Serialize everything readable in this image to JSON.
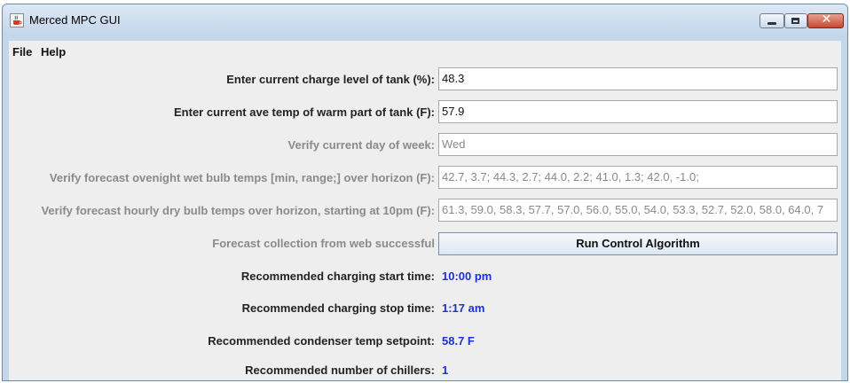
{
  "window": {
    "title": "Merced MPC GUI",
    "close_glyph": "✕"
  },
  "menu": {
    "items": [
      "File",
      "Help"
    ]
  },
  "form": {
    "charge_label": "Enter current charge level of tank (%):",
    "charge_value": "48.3",
    "temp_label": "Enter current ave temp of warm part of tank (F):",
    "temp_value": "57.9",
    "day_label": "Verify current day of week:",
    "day_value": "Wed",
    "wetbulb_label": "Verify forecast ovenight wet bulb temps [min, range;] over horizon (F):",
    "wetbulb_value": "42.7, 3.7; 44.3, 2.7; 44.0, 2.2; 41.0, 1.3; 42.0, -1.0;",
    "drybulb_label": "Verify forecast hourly dry bulb temps over horizon, starting at 10pm (F):",
    "drybulb_value": "61.3, 59.0, 58.3, 57.7, 57.0, 56.0, 55.0, 54.0, 53.3, 52.7, 52.0, 58.0, 64.0, 7",
    "status_label": "Forecast collection from web successful",
    "run_button": "Run Control Algorithm"
  },
  "results": {
    "start_label": "Recommended charging start time:",
    "start_value": "10:00 pm",
    "stop_label": "Recommended charging stop time:",
    "stop_value": "1:17 am",
    "setpoint_label": "Recommended condenser temp setpoint:",
    "setpoint_value": "58.7 F",
    "chillers_label": "Recommended number of chillers:",
    "chillers_value": "1"
  },
  "colors": {
    "result_value": "#1f2fd6",
    "disabled_text": "#8a8a8a"
  },
  "icons": {
    "app": "java-cup-icon",
    "minimize": "minimize-icon",
    "maximize": "maximize-icon",
    "close": "close-icon"
  }
}
